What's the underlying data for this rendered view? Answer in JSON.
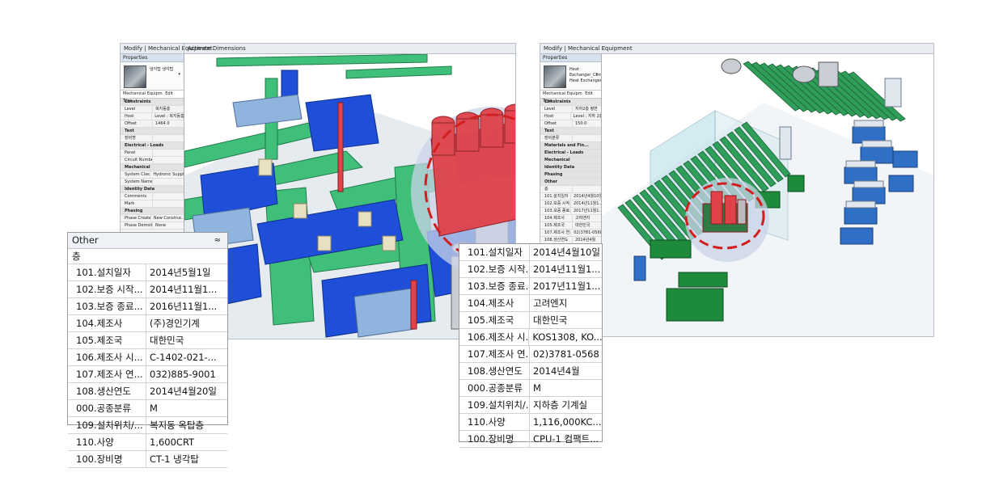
{
  "left": {
    "tab_modify": "Modify | Mechanical Equipment",
    "tab_activate": "Activate Dimensions",
    "properties_title": "Properties",
    "type_name": "냉각탑 냉각탑",
    "type_arrow": "▾",
    "type_selector": "Mechanical Equipm",
    "edit_type": "Edit Type",
    "props": [
      {
        "cat": "Constraints"
      },
      {
        "k": "Level",
        "v": "복지동층"
      },
      {
        "k": "Host",
        "v": "Level : 복지동층"
      },
      {
        "k": "Offset",
        "v": "1464.0"
      },
      {
        "cat": "Text"
      },
      {
        "k": "장비명",
        "v": ""
      },
      {
        "cat": "Electrical - Loads"
      },
      {
        "k": "Panel",
        "v": ""
      },
      {
        "k": "Circuit Number",
        "v": ""
      },
      {
        "cat": "Mechanical"
      },
      {
        "k": "System Classif...",
        "v": "Hydronic Supply"
      },
      {
        "k": "System Name",
        "v": ""
      },
      {
        "cat": "Identity Data"
      },
      {
        "k": "Comments",
        "v": ""
      },
      {
        "k": "Mark",
        "v": ""
      },
      {
        "cat": "Phasing"
      },
      {
        "k": "Phase Created",
        "v": "New Construc..."
      },
      {
        "k": "Phase Demolis...",
        "v": "None"
      }
    ]
  },
  "right": {
    "tab_modify": "Modify | Mechanical Equipment",
    "properties_title": "Properties",
    "type_name": "Heat Exchanger_Compact_... Heat Exchanger",
    "type_arrow": "▾",
    "type_selector": "Mechanical Equipm",
    "edit_type": "Edit Type",
    "props": [
      {
        "cat": "Constraints"
      },
      {
        "k": "Level",
        "v": "지하2층 평면"
      },
      {
        "k": "Host",
        "v": "Level : 지하 2층"
      },
      {
        "k": "Offset",
        "v": "150.0"
      },
      {
        "cat": "Text"
      },
      {
        "k": "장비분류",
        "v": ""
      },
      {
        "cat": "Materials and Fin..."
      },
      {
        "cat": "Electrical - Loads"
      },
      {
        "cat": "Mechanical"
      },
      {
        "cat": "Identity Data"
      },
      {
        "cat": "Phasing"
      },
      {
        "cat": "Other"
      },
      {
        "k": "층",
        "v": ""
      },
      {
        "k": "101.설치일자",
        "v": "2014년4월10일"
      },
      {
        "k": "102.보증 시작...",
        "v": "2014년11월1..."
      },
      {
        "k": "103.보증 종료...",
        "v": "2017년11월1..."
      },
      {
        "k": "104.제조사",
        "v": "고려엔지"
      },
      {
        "k": "105.제조국",
        "v": "대한민국"
      },
      {
        "k": "107.제조사 연...",
        "v": "02)3781-0568"
      },
      {
        "k": "108.생산연도",
        "v": "2014년4월"
      },
      {
        "k": "000.공종분류",
        "v": "M"
      },
      {
        "k": "109.설치위치/...",
        "v": "지하층 기계실"
      }
    ]
  },
  "table_left": {
    "header": "Other",
    "chevron": "≈",
    "sub": "층",
    "rows": [
      {
        "k": "101.설치일자",
        "v": "2014년5월1일"
      },
      {
        "k": "102.보증 시작...",
        "v": "2014년11월1..."
      },
      {
        "k": "103.보증 종료...",
        "v": "2016년11월1..."
      },
      {
        "k": "104.제조사",
        "v": "(주)경인기계"
      },
      {
        "k": "105.제조국",
        "v": "대한민국"
      },
      {
        "k": "106.제조사 시...",
        "v": "C-1402-021-..."
      },
      {
        "k": "107.제조사 연...",
        "v": "032)885-9001"
      },
      {
        "k": "108.생산연도",
        "v": "2014년4월20일"
      },
      {
        "k": "000.공종분류",
        "v": "M"
      },
      {
        "k": "109.설치위치/...",
        "v": "복지동 옥탑층"
      },
      {
        "k": "110.사양",
        "v": "1,600CRT"
      },
      {
        "k": "100.장비명",
        "v": "CT-1 냉각탑"
      }
    ]
  },
  "table_right": {
    "rows": [
      {
        "k": "101.설치일자",
        "v": "2014년4월10일"
      },
      {
        "k": "102.보증 시작...",
        "v": "2014년11월1..."
      },
      {
        "k": "103.보증 종료...",
        "v": "2017년11월1..."
      },
      {
        "k": "104.제조사",
        "v": "고려엔지"
      },
      {
        "k": "105.제조국",
        "v": "대한민국"
      },
      {
        "k": "106.제조사 시...",
        "v": "KOS1308, KO..."
      },
      {
        "k": "107.제조사 연...",
        "v": "02)3781-0568"
      },
      {
        "k": "108.생산연도",
        "v": "2014년4월"
      },
      {
        "k": "000.공종분류",
        "v": "M"
      },
      {
        "k": "109.설치위치/...",
        "v": "지하층 기계실"
      },
      {
        "k": "110.사양",
        "v": "1,116,000KC..."
      },
      {
        "k": "100.장비명",
        "v": "CPU-1 컴팩트..."
      }
    ]
  },
  "colors": {
    "pipe_green": "#3fbf7a",
    "duct_blue": "#1f4fd8",
    "equipment_red": "#e0424a",
    "highlight_ring": "#d11f1f",
    "panel_bg": "#f4f4f4"
  }
}
